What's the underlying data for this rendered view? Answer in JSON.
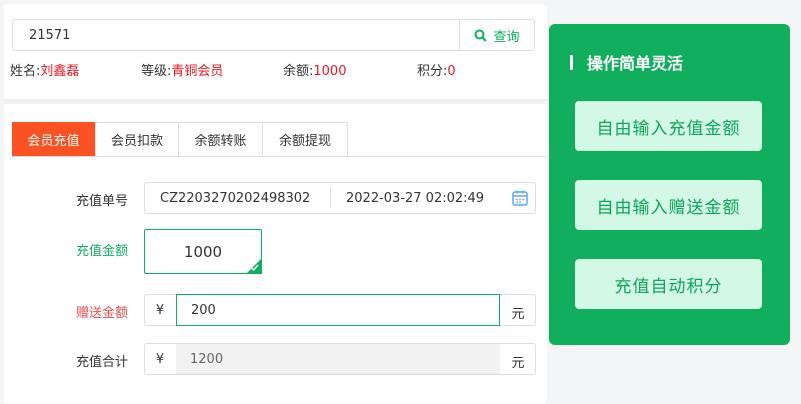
{
  "search": {
    "value": "21571",
    "button_label": "查询"
  },
  "member": {
    "name_label": "姓名:",
    "name": "刘鑫磊",
    "level_label": "等级:",
    "level": "青铜会员",
    "balance_label": "余额:",
    "balance": "1000",
    "points_label": "积分:",
    "points": "0"
  },
  "tabs": [
    "会员充值",
    "会员扣款",
    "余额转账",
    "余额提现"
  ],
  "form": {
    "order_label": "充值单号",
    "order_no": "CZ2203270202498302",
    "order_time": "2022-03-27 02:02:49",
    "amount_label": "充值金额",
    "amount": "1000",
    "gift_label": "赠送金额",
    "currency": "¥",
    "gift": "200",
    "unit": "元",
    "total_label": "充值合计",
    "total": "1200"
  },
  "features": {
    "title": "操作简单灵活",
    "items": [
      "自由输入充值金额",
      "自由输入赠送金额",
      "充值自动积分"
    ]
  },
  "colors": {
    "brand_green": "#11ae5d",
    "active_tab": "#fa5223",
    "highlight_red": "#f0141e"
  }
}
